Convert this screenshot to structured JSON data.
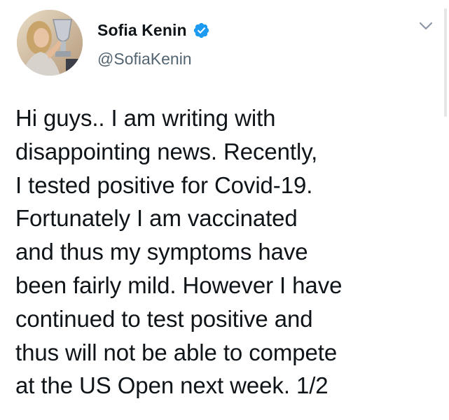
{
  "tweet": {
    "display_name": "Sofia Kenin",
    "handle": "@SofiaKenin",
    "verified": true,
    "avatar_icon": "avatar-photo",
    "menu_icon": "chevron-down-icon",
    "lines": [
      "Hi guys.. I am writing with",
      "disappointing news. Recently,",
      "I tested positive for Covid-19.",
      "Fortunately I am vaccinated",
      "and thus my symptoms have",
      "been fairly mild. However I have",
      "continued to test positive and",
      "thus will not be able to compete",
      "at the US Open next week. 1/2"
    ]
  },
  "colors": {
    "text": "#0f1419",
    "secondary_text": "#536471",
    "verified_badge": "#1d9bf0",
    "chevron": "#8b98a5"
  }
}
